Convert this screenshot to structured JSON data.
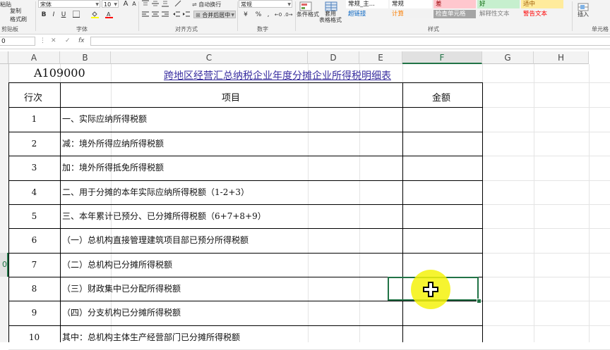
{
  "ribbon": {
    "clipboard": {
      "paste": "粘贴",
      "copy": "复制",
      "format_painter": "格式刷",
      "label": "剪贴板"
    },
    "font": {
      "name": "宋体",
      "size": "10",
      "bold": "B",
      "italic": "I",
      "underline": "U",
      "grow": "A",
      "shrink": "A",
      "label": "字体"
    },
    "alignment": {
      "wrap": "自动换行",
      "merge": "合并后居中",
      "label": "对齐方式"
    },
    "number": {
      "format": "常规",
      "percent": "%",
      "comma": ",",
      "label": "数字"
    },
    "styles": {
      "conditional": "条件格式",
      "table": "套用\n表格格式",
      "cells": [
        {
          "text": "常规_主...",
          "bg": "#ffffff",
          "fg": "#222222"
        },
        {
          "text": "常规",
          "bg": "#ffffff",
          "fg": "#222222"
        },
        {
          "text": "差",
          "bg": "#ffc7ce",
          "fg": "#9c0006"
        },
        {
          "text": "好",
          "bg": "#c6efce",
          "fg": "#006100"
        },
        {
          "text": "适中",
          "bg": "#ffeb9c",
          "fg": "#9c5700"
        },
        {
          "text": "超链接",
          "bg": "#f3f3f3",
          "fg": "#0563c1"
        },
        {
          "text": "计算",
          "bg": "#f2f2f2",
          "fg": "#fa7d00"
        },
        {
          "text": "检查单元格",
          "bg": "#a5a5a5",
          "fg": "#ffffff"
        },
        {
          "text": "解释性文本",
          "bg": "#f3f3f3",
          "fg": "#7f7f7f"
        },
        {
          "text": "警告文本",
          "bg": "#f3f3f3",
          "fg": "#ff0000"
        }
      ],
      "label": "样式"
    },
    "cells_group": {
      "insert": "插入",
      "label": "单元格"
    }
  },
  "formula_bar": {
    "name_box": "0",
    "cancel": "✕",
    "enter": "✓",
    "fx": "fx",
    "value": ""
  },
  "columns": [
    "A",
    "B",
    "C",
    "D",
    "E",
    "F",
    "G",
    "H"
  ],
  "selected_column": "F",
  "row_numbers": [
    "",
    "",
    "",
    "",
    "",
    "",
    "",
    "",
    "0",
    "",
    ""
  ],
  "sheet": {
    "code": "A109000",
    "title": "跨地区经营汇总纳税企业年度分摊企业所得税明细表",
    "header_row_no": "行次",
    "header_item": "项目",
    "header_amount": "金额",
    "rows": [
      {
        "no": "1",
        "item": "一、实际应纳所得税额"
      },
      {
        "no": "2",
        "item": "减：境外所得应纳所得税额"
      },
      {
        "no": "3",
        "item": "加：境外所得抵免所得税额"
      },
      {
        "no": "4",
        "item": "二、用于分摊的本年实际应纳所得税额（1-2+3）"
      },
      {
        "no": "5",
        "item": "三、本年累计已预分、已分摊所得税额（6+7+8+9）"
      },
      {
        "no": "6",
        "item": "（一）总机构直接管理建筑项目部已预分所得税额"
      },
      {
        "no": "7",
        "item": "（二）总机构已分摊所得税额"
      },
      {
        "no": "8",
        "item": "（三）财政集中已分配所得税额"
      },
      {
        "no": "9",
        "item": "（四）分支机构已分摊所得税额"
      },
      {
        "no": "10",
        "item": "其中：总机构主体生产经营部门已分摊所得税额"
      }
    ]
  },
  "colors": {
    "accent": "#217346",
    "title": "#3a2fa0",
    "cursor_highlight": "#f5f20c"
  }
}
